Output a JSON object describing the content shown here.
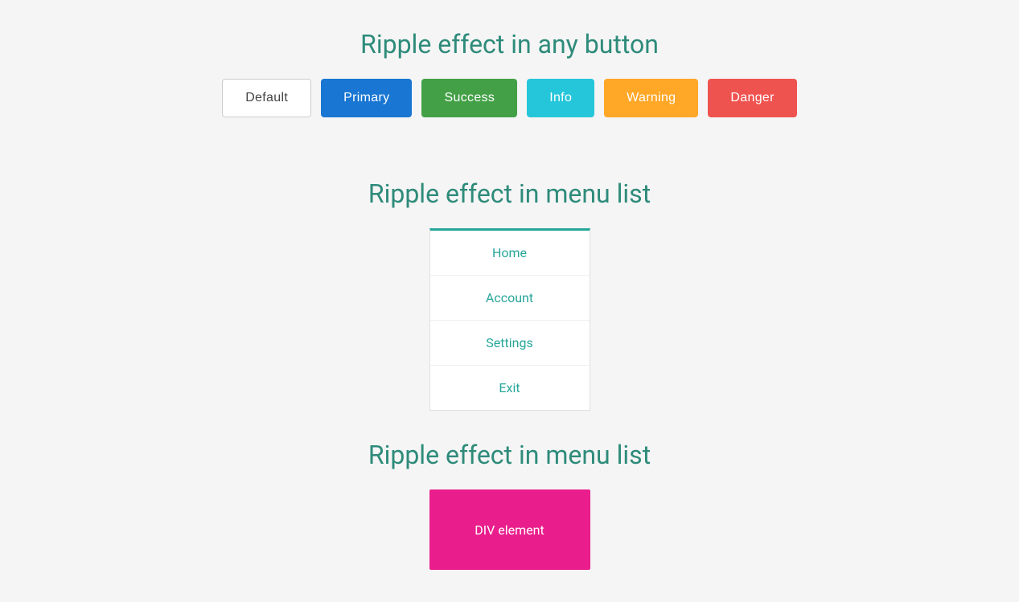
{
  "section1": {
    "title": "Ripple effect in any button",
    "buttons": [
      {
        "label": "Default",
        "variant": "default"
      },
      {
        "label": "Primary",
        "variant": "primary"
      },
      {
        "label": "Success",
        "variant": "success"
      },
      {
        "label": "Info",
        "variant": "info"
      },
      {
        "label": "Warning",
        "variant": "warning"
      },
      {
        "label": "Danger",
        "variant": "danger"
      }
    ]
  },
  "section2": {
    "title": "Ripple effect in menu list",
    "menu_items": [
      {
        "label": "Home"
      },
      {
        "label": "Account"
      },
      {
        "label": "Settings"
      },
      {
        "label": "Exit"
      }
    ]
  },
  "section3": {
    "title": "Ripple effect in menu list",
    "div_label": "DIV element"
  },
  "colors": {
    "default_bg": "#ffffff",
    "primary_bg": "#1976d2",
    "success_bg": "#43a047",
    "info_bg": "#26c6da",
    "warning_bg": "#ffa726",
    "danger_bg": "#ef5350",
    "teal": "#2e8b7a",
    "div_element_bg": "#e91e8c"
  }
}
